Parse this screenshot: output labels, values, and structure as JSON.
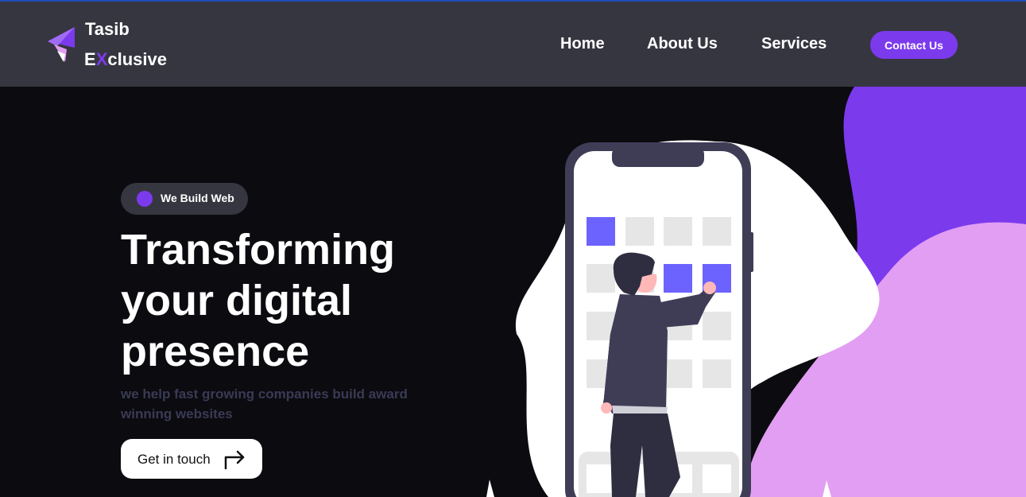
{
  "brand": {
    "line1": "Tasib",
    "line2_prefix": "E",
    "line2_accent": "X",
    "line2_suffix": "clusive",
    "accent_color": "#7c3aed"
  },
  "nav": {
    "items": [
      {
        "label": "Home"
      },
      {
        "label": "About Us"
      },
      {
        "label": "Services"
      }
    ],
    "contact_label": "Contact Us"
  },
  "hero": {
    "badge": "We Build Web",
    "headline": "Transforming your digital presence",
    "subtext": "we help fast growing companies build award winning websites",
    "cta_label": "Get in touch",
    "cta_icon": "arrow-turn-right-icon"
  },
  "colors": {
    "navbar": "#363641",
    "background": "#0b0b10",
    "accent": "#7c3aed",
    "illustration_pink": "#e29ef2",
    "tile_blue": "#6c63ff"
  }
}
